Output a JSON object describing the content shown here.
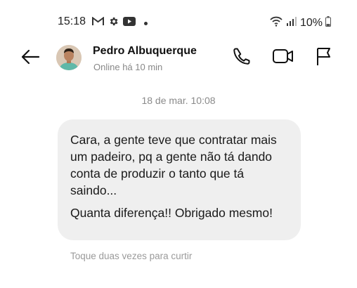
{
  "status_bar": {
    "time": "15:18",
    "icons": [
      "gmail-icon",
      "gear-icon",
      "youtube-icon",
      "dot-icon"
    ],
    "battery": "10%"
  },
  "header": {
    "contact_name": "Pedro Albuquerque",
    "contact_status": "Online há 10 min",
    "buttons": [
      "back-arrow-icon",
      "phone-icon",
      "video-camera-icon",
      "flag-icon"
    ]
  },
  "conversation": {
    "timestamp": "18 de mar. 10:08",
    "message": {
      "paragraph_1": "Cara, a gente teve que contratar mais um padeiro, pq a gente não tá dando conta de produzir o tanto que tá saindo...",
      "paragraph_2": "Quanta diferença!! Obrigado mesmo!"
    },
    "like_hint": "Toque duas vezes para curtir"
  },
  "colors": {
    "bubble_bg": "#efefef",
    "muted_text": "#8a8a8a"
  }
}
